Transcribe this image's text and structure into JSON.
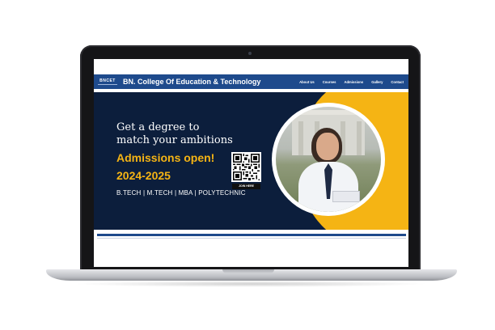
{
  "site": {
    "logo_text": "BNCET",
    "title": "BN. College Of Education & Technology"
  },
  "nav": {
    "items": [
      "About Us",
      "Courses",
      "Admissions",
      "Gallery",
      "Contact"
    ]
  },
  "hero": {
    "headline_line1": "Get a degree to",
    "headline_line2": "match your ambitions",
    "admissions": "Admissions open!",
    "year": "2024-2025",
    "courses": "B.TECH | M.TECH | MBA | POLYTECHNIC",
    "qr_label": "JOIN HERE"
  },
  "colors": {
    "header_blue": "#1e4a8c",
    "hero_navy": "#0c1e3c",
    "accent_yellow": "#f5b414"
  }
}
